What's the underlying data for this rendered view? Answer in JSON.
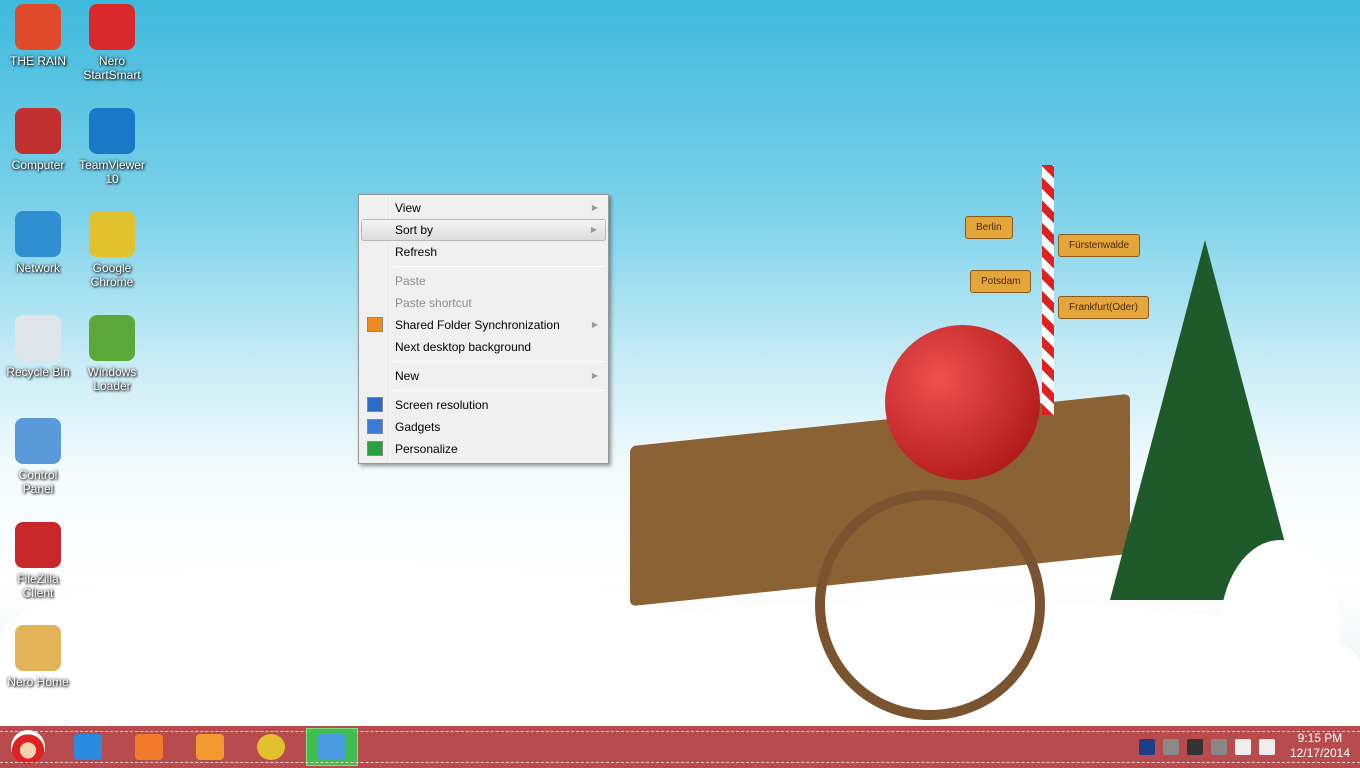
{
  "desktop_icons": [
    {
      "label": "THE RAIN",
      "icon": "snowman-folder-icon",
      "color": "#e04a2a"
    },
    {
      "label": "Nero StartSmart",
      "icon": "nero-flame-icon",
      "color": "#d8282b"
    },
    {
      "label": "Computer",
      "icon": "computer-icon",
      "color": "#c0302e"
    },
    {
      "label": "TeamViewer 10",
      "icon": "teamviewer-icon",
      "color": "#1a78c8"
    },
    {
      "label": "Network",
      "icon": "network-globe-icon",
      "color": "#2f8fd0"
    },
    {
      "label": "Google Chrome",
      "icon": "chrome-icon",
      "color": "#e2c12f"
    },
    {
      "label": "Recycle Bin",
      "icon": "recycle-bin-icon",
      "color": "#dfe6ea"
    },
    {
      "label": "Windows Loader",
      "icon": "windows-loader-icon",
      "color": "#5aa83a"
    },
    {
      "label": "Control Panel",
      "icon": "control-panel-icon",
      "color": "#5a9ad8"
    },
    {
      "label": "FileZilla Client",
      "icon": "filezilla-icon",
      "color": "#c8272a"
    },
    {
      "label": "Nero Home",
      "icon": "nero-home-icon",
      "color": "#e3b35a"
    }
  ],
  "context_menu": {
    "items": [
      {
        "label": "View",
        "submenu": true
      },
      {
        "label": "Sort by",
        "submenu": true,
        "highlighted": true
      },
      {
        "label": "Refresh"
      },
      {
        "label": "Paste",
        "disabled": true
      },
      {
        "label": "Paste shortcut",
        "disabled": true
      },
      {
        "label": "Shared Folder Synchronization",
        "submenu": true,
        "icon": "shared-folder-sync-icon"
      },
      {
        "label": "Next desktop background"
      },
      {
        "label": "New",
        "submenu": true
      },
      {
        "label": "Screen resolution",
        "icon": "screen-resolution-icon"
      },
      {
        "label": "Gadgets",
        "icon": "gadgets-icon"
      },
      {
        "label": "Personalize",
        "icon": "personalize-icon"
      }
    ]
  },
  "wallpaper_signs": [
    "Berlin",
    "Fürstenwalde",
    "Potsdam",
    "Frankfurt(Oder)"
  ],
  "taskbar": {
    "start": "santa-start-icon",
    "pinned": [
      "internet-explorer-icon",
      "file-explorer-icon",
      "media-player-icon",
      "chrome-icon",
      "remote-desktop-icon"
    ],
    "tray": [
      "virtualbox-icon",
      "safely-remove-icon",
      "tray-app-icon",
      "vmware-icon",
      "network-icon",
      "volume-icon"
    ],
    "time": "9:15 PM",
    "date": "12/17/2014"
  }
}
